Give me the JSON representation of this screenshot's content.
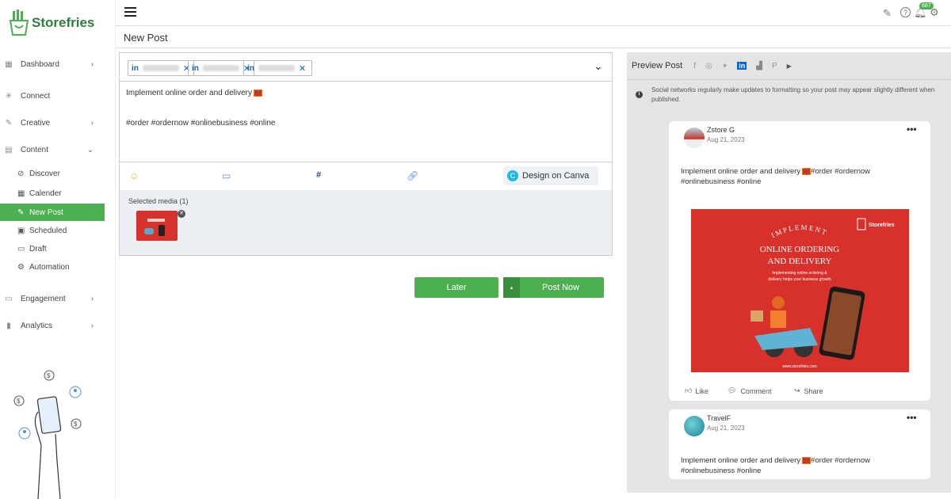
{
  "app": {
    "brand": "Storefries"
  },
  "sidebar": {
    "items": [
      {
        "label": "Dashboard",
        "icon": "dashboard-icon",
        "chevron": "›"
      },
      {
        "label": "Connect",
        "icon": "connect-icon"
      },
      {
        "label": "Creative",
        "icon": "brush-icon",
        "chevron": "›"
      },
      {
        "label": "Content",
        "icon": "content-icon",
        "chevron": "⌄"
      },
      {
        "label": "Engagement",
        "icon": "engagement-icon",
        "chevron": "›"
      },
      {
        "label": "Analytics",
        "icon": "analytics-icon",
        "chevron": "›"
      }
    ],
    "content_sub": [
      {
        "label": "Discover",
        "icon": "compass-icon"
      },
      {
        "label": "Calender",
        "icon": "calendar-icon"
      },
      {
        "label": "New Post",
        "icon": "edit-icon",
        "active": true
      },
      {
        "label": "Scheduled",
        "icon": "scheduled-icon"
      },
      {
        "label": "Draft",
        "icon": "draft-icon"
      },
      {
        "label": "Automation",
        "icon": "automation-icon"
      }
    ]
  },
  "topbar": {
    "notification_count": "887"
  },
  "page": {
    "title": "New Post"
  },
  "composer": {
    "channels": [
      {
        "network": "in"
      },
      {
        "network": "in"
      },
      {
        "network": "in"
      }
    ],
    "text_line1": "Implement online order and delivery",
    "text_line2": "#order #ordernow #onlinebusiness #online",
    "toolbar": {
      "canva_label": "Design on Canva",
      "hashtag": "#"
    },
    "selected_media_label": "Selected media (1)"
  },
  "actions": {
    "later_label": "Later",
    "post_now_label": "Post Now"
  },
  "preview": {
    "title": "Preview Post",
    "notice": "Social networks regularly make updates to formatting so your post may appear slightly different when published.",
    "posts": [
      {
        "name": "Zstore G",
        "date": "Aug 21, 2023",
        "text1": "Implement online order and delivery",
        "text1b": " #order #ordernow",
        "text2": "#onlinebusiness #online"
      },
      {
        "name": "TravelF",
        "date": "Aug 21, 2023",
        "text1": "Implement online order and delivery",
        "text1b": " #order #ordernow",
        "text2": "#onlinebusiness #online"
      }
    ],
    "actions": {
      "like": "Like",
      "comment": "Comment",
      "share": "Share"
    },
    "image": {
      "arc_text": "IMPLEMENT",
      "headline1": "ONLINE ORDERING",
      "headline2": "AND DELIVERY",
      "sub1": "Implementing online ordering &",
      "sub2": "delivery helps your business growth",
      "brand": "Storefries",
      "url": "www.storefries.com"
    }
  },
  "colors": {
    "accent": "#4caf50",
    "linkedin": "#0a66c2",
    "promo_red": "#d8302a"
  }
}
